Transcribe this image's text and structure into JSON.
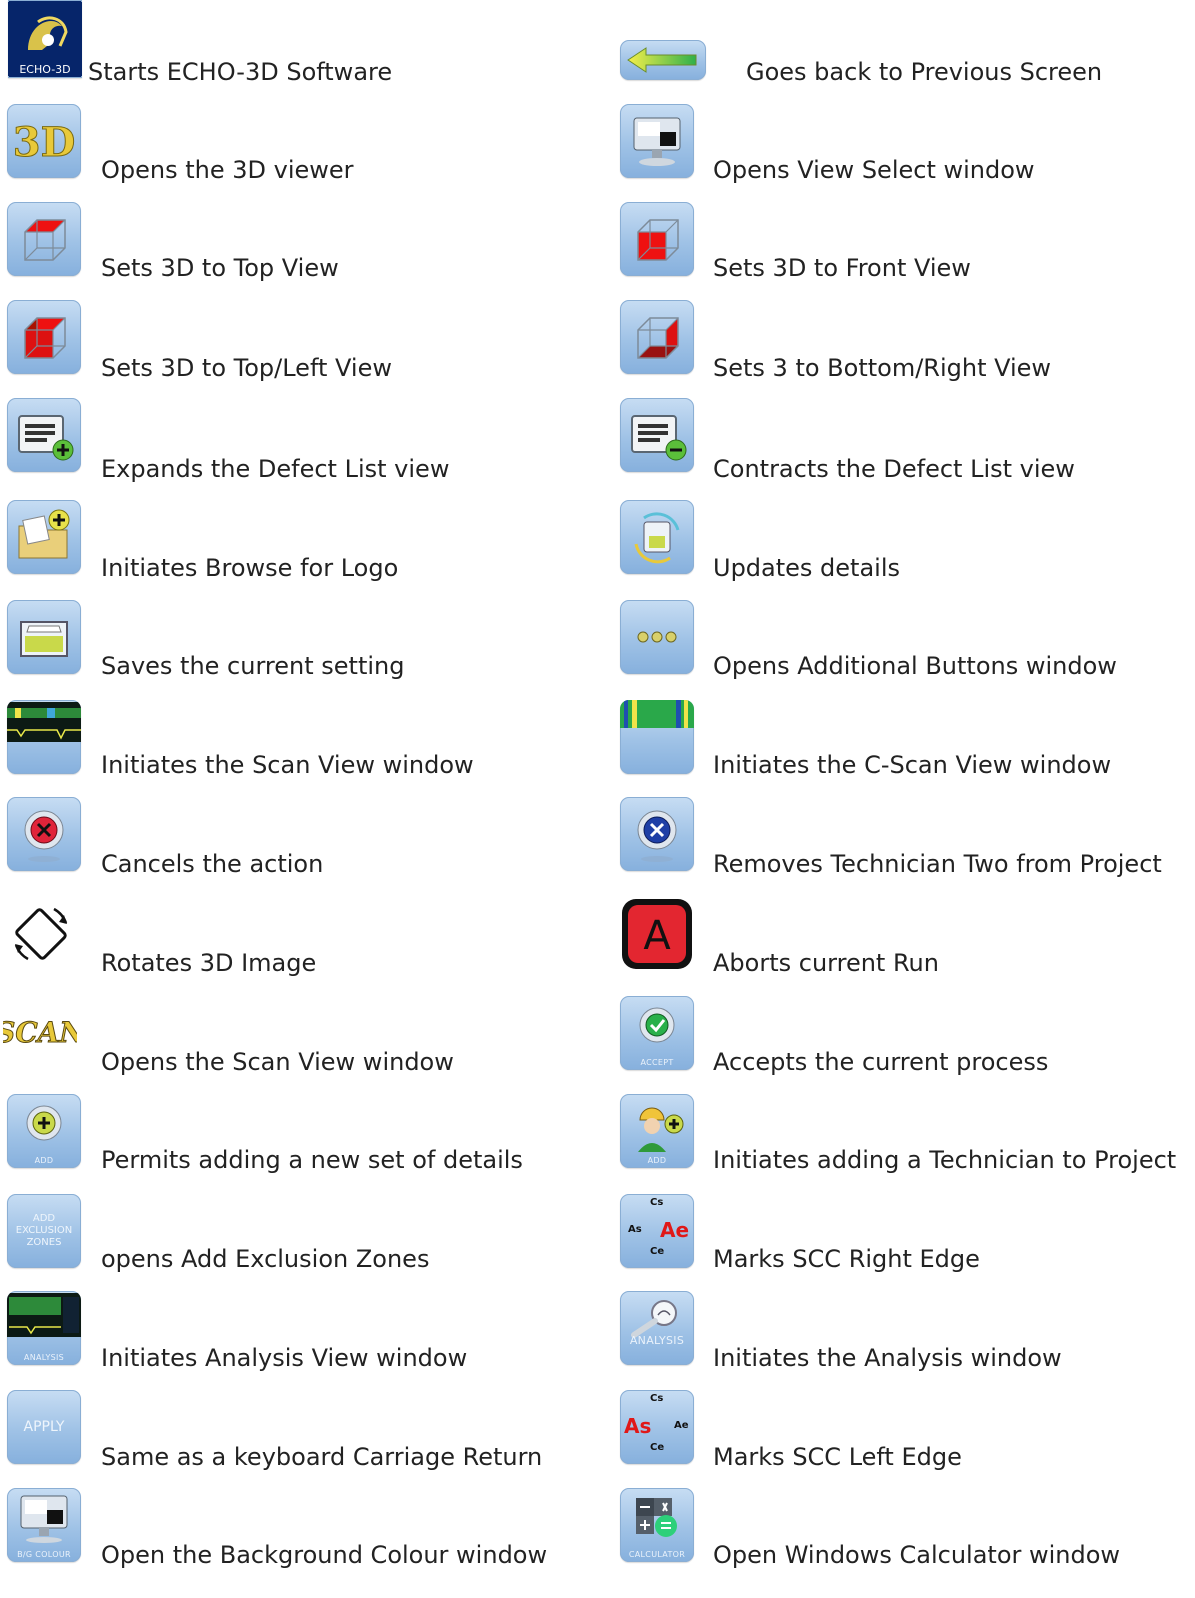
{
  "rows": [
    {
      "left": {
        "icon": "echo-3d-app-icon",
        "caption": "ECHO-3D",
        "label": "Starts ECHO-3D Software"
      },
      "right": {
        "icon": "back-arrow-icon",
        "label": "Goes back to Previous Screen"
      }
    },
    {
      "left": {
        "icon": "3d-viewer-icon",
        "label": "Opens the 3D viewer"
      },
      "right": {
        "icon": "view-select-monitor-icon",
        "label": "Opens View Select window"
      }
    },
    {
      "left": {
        "icon": "cube-top-view-icon",
        "label": "Sets 3D to Top View"
      },
      "right": {
        "icon": "cube-front-view-icon",
        "label": "Sets 3D to Front View"
      }
    },
    {
      "left": {
        "icon": "cube-top-left-view-icon",
        "label": "Sets 3D to Top/Left View"
      },
      "right": {
        "icon": "cube-bottom-right-view-icon",
        "label": "Sets 3 to Bottom/Right View"
      }
    },
    {
      "left": {
        "icon": "list-expand-icon",
        "label": "Expands the Defect List view"
      },
      "right": {
        "icon": "list-contract-icon",
        "label": "Contracts the Defect List view"
      }
    },
    {
      "left": {
        "icon": "browse-folder-icon",
        "label": "Initiates Browse for Logo"
      },
      "right": {
        "icon": "update-details-icon",
        "label": "Updates details"
      }
    },
    {
      "left": {
        "icon": "save-disk-icon",
        "label": "Saves the current setting"
      },
      "right": {
        "icon": "more-dots-icon",
        "label": "Opens Additional Buttons window"
      }
    },
    {
      "left": {
        "icon": "scan-view-graph-icon",
        "label": "Initiates the Scan View window"
      },
      "right": {
        "icon": "c-scan-view-icon",
        "label": "Initiates the C-Scan View window"
      }
    },
    {
      "left": {
        "icon": "cancel-x-icon",
        "label": "Cancels the action"
      },
      "right": {
        "icon": "remove-technician-icon",
        "label": "Removes Technician Two from Project"
      }
    },
    {
      "left": {
        "icon": "rotate-icon",
        "label": "Rotates 3D Image"
      },
      "right": {
        "icon": "abort-icon",
        "caption": "A",
        "label": "Aborts current Run"
      }
    },
    {
      "left": {
        "icon": "scan-text-icon",
        "caption": "SCAN",
        "label": "Opens the Scan View window"
      },
      "right": {
        "icon": "accept-check-icon",
        "caption": "ACCEPT",
        "label": "Accepts the current process"
      }
    },
    {
      "left": {
        "icon": "add-plus-icon",
        "caption": "ADD",
        "label": "Permits adding a new set of details"
      },
      "right": {
        "icon": "add-technician-icon",
        "caption": "ADD",
        "label": "Initiates adding a Technician to Project"
      }
    },
    {
      "left": {
        "icon": "add-exclusion-zones-icon",
        "caption_lines": [
          "ADD",
          "EXCLUSION",
          "ZONES"
        ],
        "label": "opens Add Exclusion Zones"
      },
      "right": {
        "icon": "scc-right-edge-icon",
        "scc": {
          "top": "Cs",
          "left": "As",
          "right": "Ae",
          "bottom": "Ce"
        },
        "label": "Marks SCC Right Edge"
      }
    },
    {
      "left": {
        "icon": "analysis-view-icon",
        "caption": "ANALYSIS",
        "label": "Initiates Analysis View window"
      },
      "right": {
        "icon": "analysis-magnifier-icon",
        "caption": "ANALYSIS",
        "label": "Initiates the Analysis window"
      }
    },
    {
      "left": {
        "icon": "apply-icon",
        "caption": "APPLY",
        "label": "Same as a keyboard Carriage Return"
      },
      "right": {
        "icon": "scc-left-edge-icon",
        "scc": {
          "top": "Cs",
          "left": "As",
          "right": "Ae",
          "bottom": "Ce"
        },
        "label": "Marks SCC Left Edge"
      }
    },
    {
      "left": {
        "icon": "background-colour-icon",
        "caption": "B/G COLOUR",
        "label": "Open the Background Colour window"
      },
      "right": {
        "icon": "calculator-icon",
        "caption": "CALCULATOR",
        "label": "Open Windows Calculator window"
      }
    }
  ]
}
